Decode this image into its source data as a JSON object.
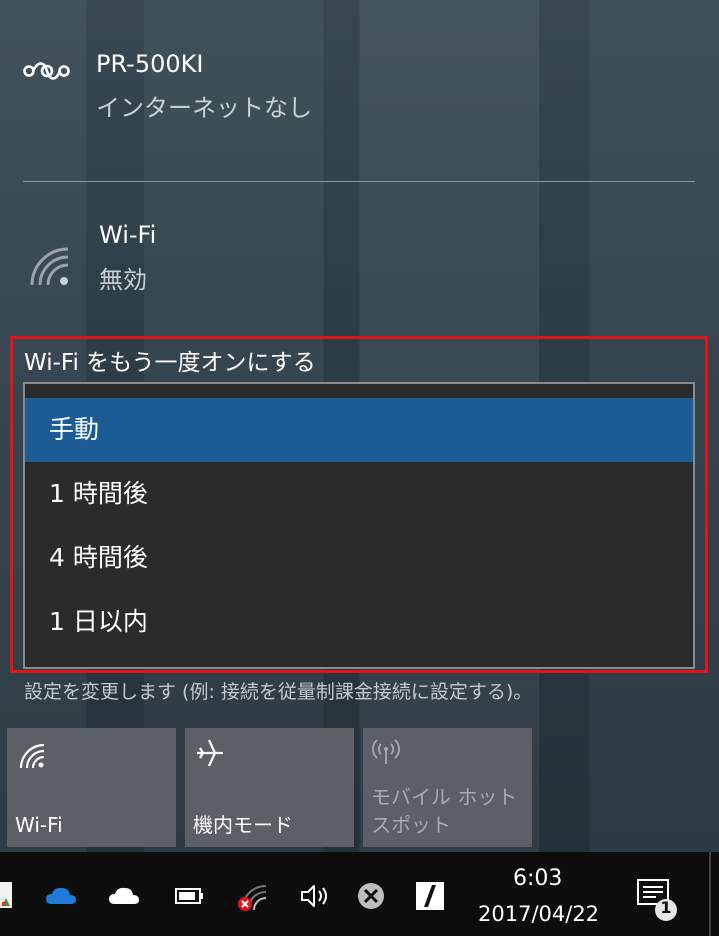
{
  "networks": [
    {
      "name": "PR-500KI",
      "status": "インターネットなし"
    },
    {
      "name": "Wi-Fi",
      "status": "無効"
    }
  ],
  "turn_on": {
    "label": "Wi-Fi をもう一度オンにする",
    "options": [
      "手動",
      "1 時間後",
      "4 時間後",
      "1 日以内"
    ],
    "selected": "手動"
  },
  "settings_hint": "設定を変更します (例: 接続を従量制課金接続に設定する)。",
  "quick_actions": [
    {
      "label": "Wi-Fi",
      "icon": "wifi-icon",
      "enabled": true
    },
    {
      "label": "機内モード",
      "icon": "airplane-icon",
      "enabled": true
    },
    {
      "label": "モバイル ホットスポット",
      "icon": "hotspot-icon",
      "enabled": false
    }
  ],
  "taskbar": {
    "time": "6:03",
    "date": "2017/04/22",
    "notification_count": "1",
    "icons": [
      "app-icon",
      "onedrive-icon",
      "onedrive-personal-icon",
      "battery-icon",
      "network-error-icon",
      "volume-icon",
      "close-circle-icon",
      "adobe-icon",
      "action-center-icon"
    ]
  },
  "colors": {
    "selected_option": "#1c5c96",
    "highlight_border": "#e0151c",
    "tile_bg": "#5a6066",
    "taskbar_bg": "#0d0d0d"
  }
}
